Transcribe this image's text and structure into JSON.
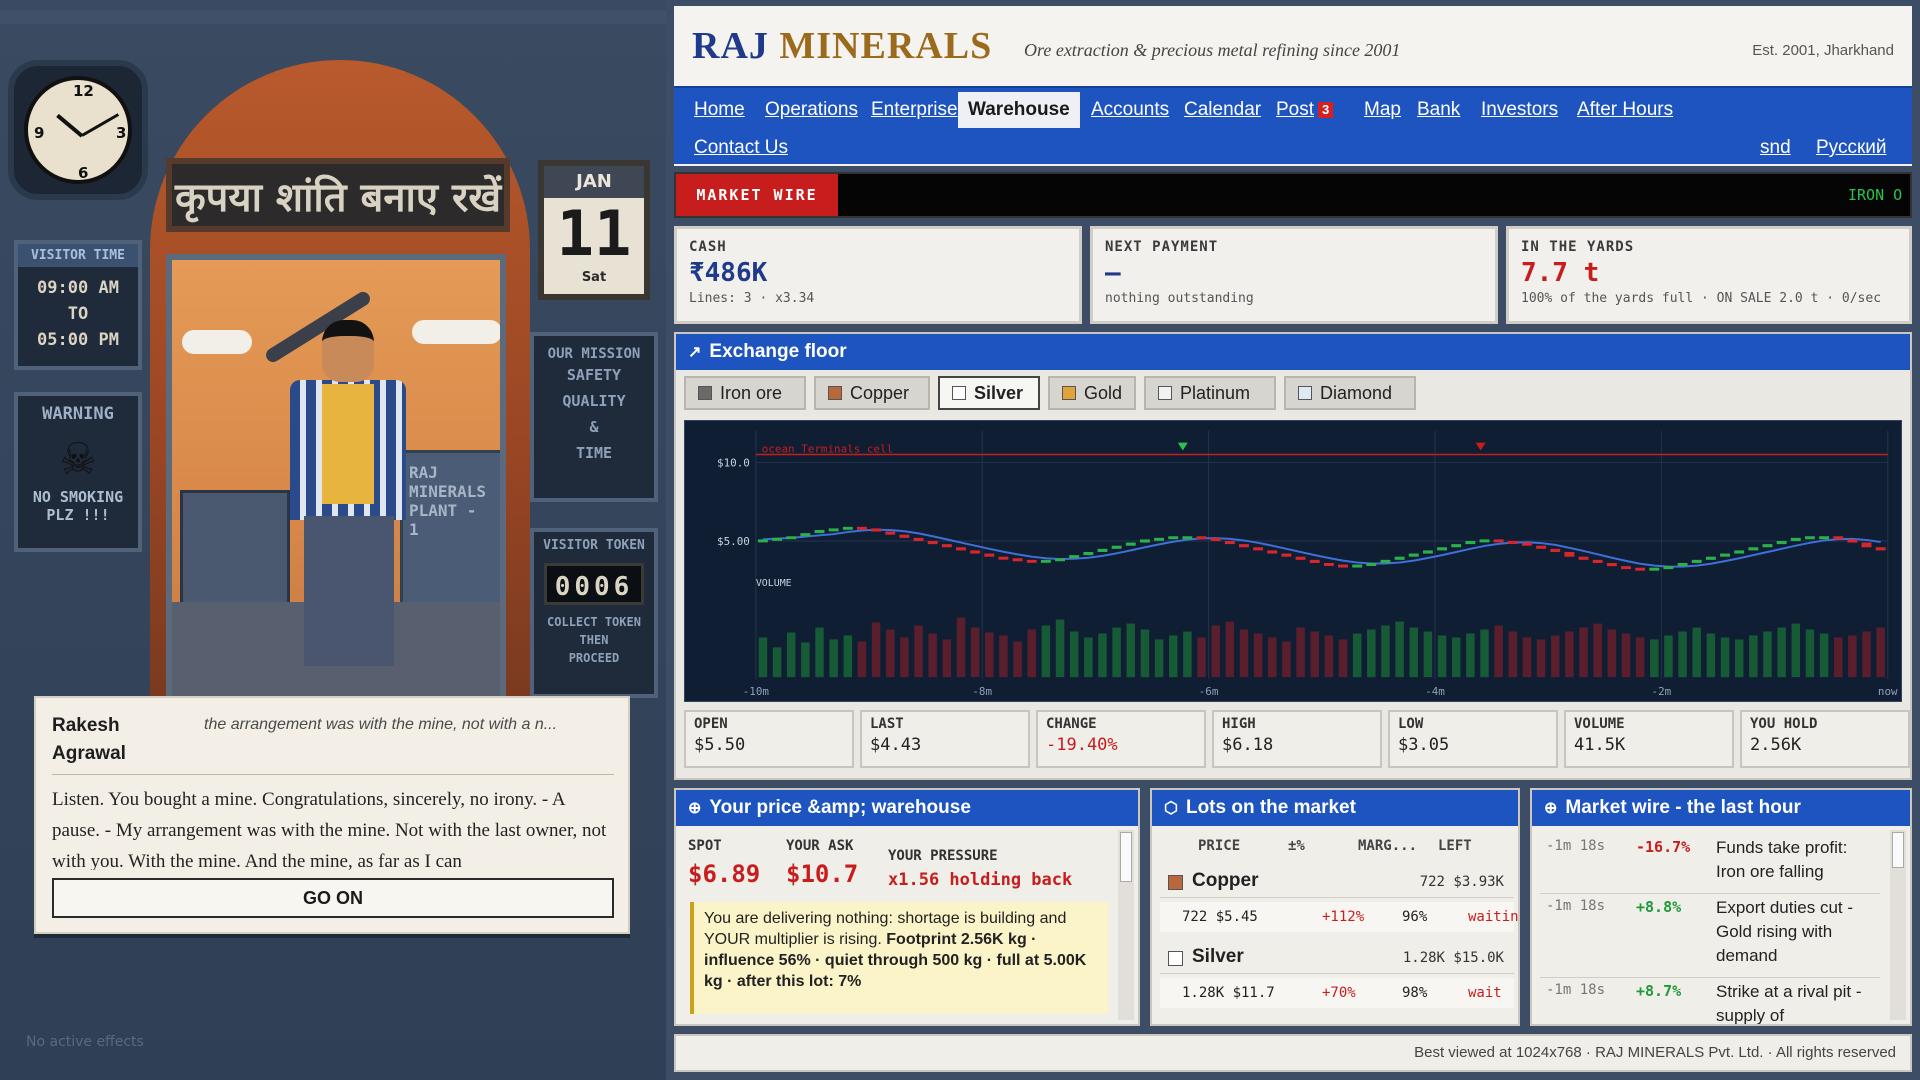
{
  "scene": {
    "sign_hindi": "कृपया शांति बनाए रखें",
    "calendar": {
      "month": "JAN",
      "day": "11",
      "weekday": "Sat"
    },
    "visitor_time": {
      "title": "VISITOR TIME",
      "from": "09:00 AM",
      "to_word": "TO",
      "until": "05:00 PM"
    },
    "warning": {
      "title": "WARNING",
      "footer_line1": "NO SMOKING",
      "footer_line2": "PLZ !!!"
    },
    "mission": {
      "title": "OUR MISSION",
      "lines": [
        "SAFETY",
        "QUALITY",
        "&",
        "TIME"
      ]
    },
    "token": {
      "title": "VISITOR TOKEN",
      "number": "0006",
      "footer_line1": "COLLECT TOKEN",
      "footer_line2": "THEN",
      "footer_line3": "PROCEED"
    },
    "building_label": "RAJ\nMINERALS\nPLANT - 1",
    "no_effects": "No active effects"
  },
  "dialog": {
    "speaker": "Rakesh Agrawal",
    "quote": "the arrangement was with the mine, not with a n...",
    "text": "Listen. You bought a mine. Congratulations, sincerely, no irony. - A pause. - My arrangement was with the mine. Not with the last owner, not with you. With the mine. And the mine, as far as I can",
    "button": "GO ON"
  },
  "site": {
    "logo_a": "RAJ",
    "logo_b": "MINERALS",
    "tagline": "Ore extraction & precious metal refining since 2001",
    "est": "Est. 2001, Jharkhand",
    "nav": [
      "Home",
      "Operations",
      "Enterprise",
      "Warehouse",
      "Accounts",
      "Calendar",
      "Post",
      "Map",
      "Bank",
      "Investors",
      "After Hours"
    ],
    "nav_post_badge": "3",
    "nav_row2": {
      "contact": "Contact Us",
      "snd": "snd",
      "lang": "Русский"
    },
    "wire_label": "MARKET WIRE",
    "wire_ticker": "IRON O",
    "cards": {
      "cash": {
        "label": "CASH",
        "value": "₹486K",
        "sub": "Lines: 3 · x3.34"
      },
      "next_payment": {
        "label": "NEXT PAYMENT",
        "value": "—",
        "sub": "nothing outstanding"
      },
      "yards": {
        "label": "IN THE YARDS",
        "value": "7.7 t",
        "sub": "100% of the yards full · ON SALE 2.0 t · 0/sec"
      }
    },
    "exchange": {
      "title": "Exchange floor",
      "tabs": [
        "Iron ore",
        "Copper",
        "Silver",
        "Gold",
        "Platinum",
        "Diamond"
      ],
      "tab_colors": [
        "#6a6a6a",
        "#b8683a",
        "#ffffff",
        "#e0a43a",
        "#f2f2f2",
        "#dfe9f5"
      ],
      "active_tab": "Silver",
      "ohlc": [
        {
          "label": "OPEN",
          "value": "$5.50",
          "color": "#222222"
        },
        {
          "label": "LAST",
          "value": "$4.43",
          "color": "#222222"
        },
        {
          "label": "CHANGE",
          "value": "-19.40%",
          "color": "#c81d1d"
        },
        {
          "label": "HIGH",
          "value": "$6.18",
          "color": "#222222"
        },
        {
          "label": "LOW",
          "value": "$3.05",
          "color": "#222222"
        },
        {
          "label": "VOLUME",
          "value": "41.5K",
          "color": "#222222"
        },
        {
          "label": "YOU HOLD",
          "value": "2.56K",
          "color": "#222222"
        }
      ]
    },
    "your_price": {
      "title": "Your price &amp; warehouse",
      "spot_label": "SPOT",
      "spot": "$6.89",
      "ask_label": "YOUR ASK",
      "ask": "$10.7",
      "pressure_label": "YOUR PRESSURE",
      "pressure": "x1.56 holding back",
      "note_plain": "You are delivering nothing: shortage is building and YOUR multiplier is rising.",
      "note_bold": "Footprint 2.56K kg · influence 56% · quiet through 500 kg · full at 5.00K kg · after this lot: 7%"
    },
    "lots": {
      "title": "Lots on the market",
      "headers": [
        "PRICE",
        "±%",
        "MARG...",
        "LEFT"
      ],
      "groups": [
        {
          "name": "Copper",
          "color": "#b8683a",
          "summary": "722 $3.93K",
          "row": [
            "722 $5.45",
            "+112%",
            "96%",
            "waitin"
          ]
        },
        {
          "name": "Silver",
          "color": "#ffffff",
          "summary": "1.28K $15.0K",
          "row": [
            "1.28K $11.7",
            "+70%",
            "98%",
            "wait"
          ]
        }
      ]
    },
    "wire_hour": {
      "title": "Market wire - the last hour",
      "items": [
        {
          "time": "-1m 18s",
          "change": "-16.7%",
          "text": "Funds take profit: Iron ore falling",
          "color": "#c81d1d"
        },
        {
          "time": "-1m 18s",
          "change": "+8.8%",
          "text": "Export duties cut - Gold rising with demand",
          "color": "#1f9a36"
        },
        {
          "time": "-1m 18s",
          "change": "+8.7%",
          "text": "Strike at a rival pit - supply of",
          "color": "#1f9a36"
        }
      ]
    },
    "footer": "Best viewed at 1024x768 · RAJ MINERALS Pvt. Ltd. · All rights reserved"
  },
  "chart_data": {
    "type": "candlestick",
    "series_name": "Silver",
    "x_ticks": [
      "-10m",
      "-8m",
      "-6m",
      "-4m",
      "-2m",
      "now"
    ],
    "y_ticks": [
      "$10.0",
      "$5.00"
    ],
    "ylim": [
      0,
      12
    ],
    "target_line_label": "ocean Terminals cell",
    "target_line_value": 10.5,
    "volume_label": "VOLUME",
    "closes": [
      5.1,
      5.2,
      5.3,
      5.5,
      5.7,
      5.8,
      5.9,
      5.8,
      5.6,
      5.4,
      5.2,
      5.0,
      4.8,
      4.6,
      4.4,
      4.2,
      4.0,
      3.9,
      3.8,
      3.7,
      3.8,
      3.9,
      4.1,
      4.3,
      4.5,
      4.7,
      4.9,
      5.1,
      5.2,
      5.3,
      5.3,
      5.2,
      5.0,
      4.8,
      4.6,
      4.4,
      4.2,
      4.0,
      3.8,
      3.6,
      3.5,
      3.4,
      3.5,
      3.6,
      3.8,
      4.0,
      4.2,
      4.4,
      4.6,
      4.8,
      5.0,
      5.1,
      5.0,
      4.9,
      4.7,
      4.5,
      4.3,
      4.0,
      3.8,
      3.6,
      3.4,
      3.3,
      3.2,
      3.3,
      3.4,
      3.6,
      3.8,
      4.0,
      4.2,
      4.4,
      4.6,
      4.8,
      5.0,
      5.2,
      5.3,
      5.3,
      5.1,
      4.9,
      4.6,
      4.4
    ],
    "volumes": [
      40,
      30,
      45,
      35,
      50,
      38,
      42,
      36,
      55,
      48,
      40,
      52,
      44,
      38,
      60,
      50,
      45,
      42,
      36,
      48,
      52,
      58,
      46,
      40,
      44,
      50,
      54,
      48,
      38,
      42,
      46,
      40,
      52,
      56,
      48,
      44,
      40,
      36,
      50,
      46,
      42,
      38,
      44,
      48,
      52,
      56,
      50,
      46,
      42,
      40,
      44,
      48,
      52,
      46,
      40,
      38,
      42,
      46,
      50,
      54,
      48,
      44,
      40,
      38,
      42,
      46,
      50,
      44,
      40,
      38,
      42,
      46,
      50,
      54,
      48,
      44,
      40,
      42,
      46,
      50
    ]
  }
}
